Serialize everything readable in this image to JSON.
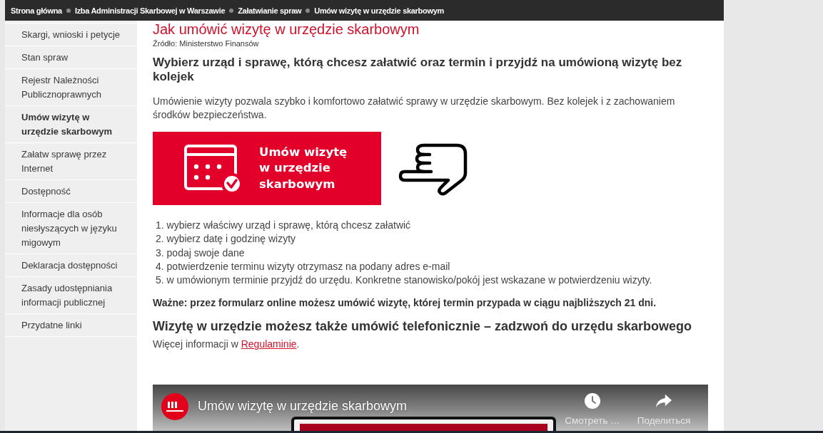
{
  "breadcrumb": [
    {
      "label": "Strona główna"
    },
    {
      "label": "Izba Administracji Skarbowej w Warszawie"
    },
    {
      "label": "Załatwianie spraw"
    },
    {
      "label": "Umów wizytę w urzędzie skarbowym"
    }
  ],
  "sidebar": {
    "items": [
      {
        "label": "Skargi, wnioski i petycje",
        "selected": false
      },
      {
        "label": "Stan spraw",
        "selected": false
      },
      {
        "label": "Rejestr Należności Publicznoprawnych",
        "selected": false
      },
      {
        "label": "Umów wizytę w urzędzie skarbowym",
        "selected": true
      },
      {
        "label": "Załatw sprawę przez Internet",
        "selected": false
      },
      {
        "label": "Dostępność",
        "selected": false
      },
      {
        "label": "Informacje dla osób niesłyszących w języku migowym",
        "selected": false
      },
      {
        "label": "Deklaracja dostępności",
        "selected": false
      },
      {
        "label": "Zasady udostępniania informacji publicznej",
        "selected": false
      },
      {
        "label": "Przydatne linki",
        "selected": false
      }
    ]
  },
  "article": {
    "title": "Jak umówić wizytę w urzędzie skarbowym",
    "source": "Źródło: Ministerstwo Finansów",
    "lead_heading": "Wybierz urząd i sprawę, którą chcesz załatwić oraz termin i przyjdź na umówioną wizytę bez kolejek",
    "intro": "Umówienie wizyty pozwala szybko i komfortowo załatwić sprawy w urzędzie skarbowym. Bez kolejek i z zachowaniem środków bezpieczeństwa.",
    "banner": {
      "text": "Umów wizytę w urzędzie skarbowym"
    },
    "steps": [
      "1. wybierz właściwy urząd i sprawę, którą chcesz załatwić",
      "2. wybierz datę i godzinę wizyty",
      "3. podaj swoje dane",
      "4. potwierdzenie terminu wizyty otrzymasz na podany adres e-mail",
      "5. w umówionym terminie przyjdź do urzędu. Konkretne stanowisko/pokój jest wskazane w potwierdzeniu wizyty."
    ],
    "notice": "Ważne: przez formularz online możesz umówić wizytę, której termin przypada w ciągu najbliższych 21 dni.",
    "phone_heading": "Wizytę w urzędzie możesz także umówić telefonicznie – zadzwoń do urzędu skarbowego",
    "more_info": {
      "text": "Więcej informacji w ",
      "link": "Regulaminie",
      "after": "."
    }
  },
  "video": {
    "title": "Umów wizytę w urzędzie skarbowym",
    "actions": [
      {
        "kind": "watch_later",
        "label": "Смотреть …"
      },
      {
        "kind": "share",
        "label": "Поделиться"
      }
    ]
  }
}
